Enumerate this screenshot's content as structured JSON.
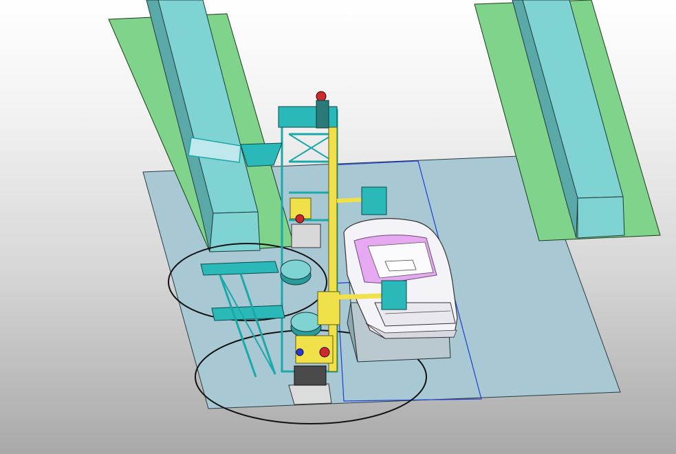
{
  "viewport": {
    "kind": "CAD 3D assembly viewport",
    "background_colors": [
      "#ffffff",
      "#a9a9a9"
    ]
  },
  "scene": {
    "floor_color": "#a8c8d4",
    "work_zone_line_color": "#1f3ad6",
    "conveyor_colors": {
      "top": "#7fd38a",
      "body": "#7fd3d3",
      "shade": "#5aa8a8"
    },
    "frame_color": "#1aa8a8",
    "robot_color": "#f0e14a",
    "robot_accent_color": "#cc2a2a",
    "car_body_color": "#f4f4f8",
    "car_interior_color": "#e6a8f0",
    "reach_circle_color": "#111111",
    "objects": [
      "left-conveyor",
      "right-conveyor",
      "floor-plate",
      "gantry-tower",
      "wheel-rack",
      "upper-robot",
      "lower-robot",
      "car-body",
      "car-fixture",
      "robot-base-plate",
      "reach-circle-upper",
      "reach-circle-lower"
    ]
  }
}
